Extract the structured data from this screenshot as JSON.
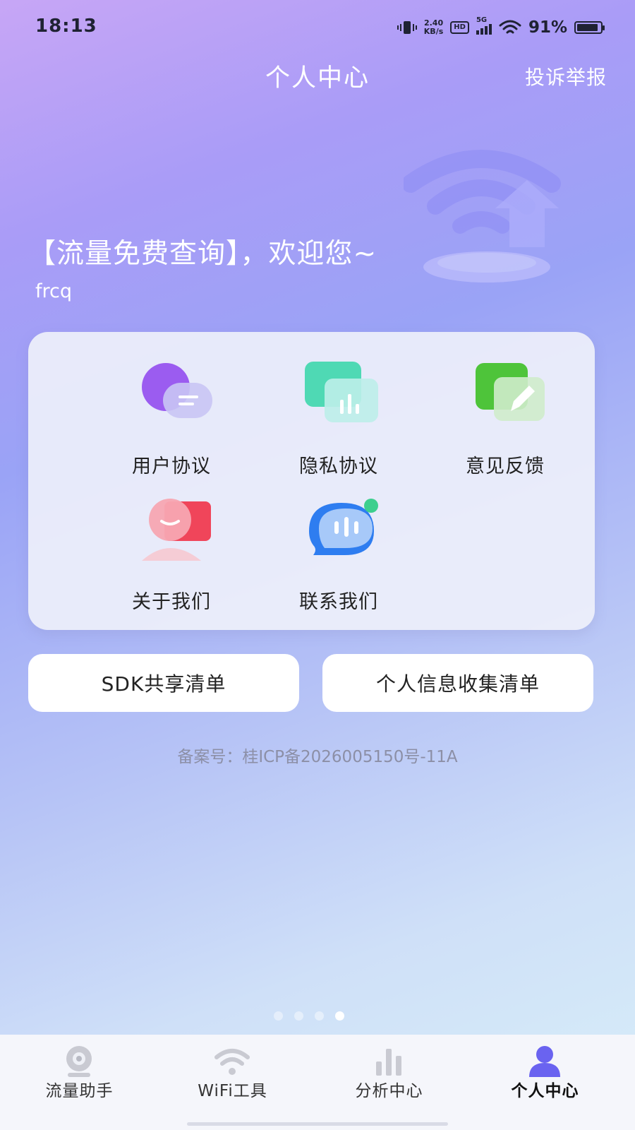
{
  "status_bar": {
    "time": "18:13",
    "net_speed": "2.40",
    "net_unit": "KB/s",
    "hd": "HD",
    "network": "5G",
    "battery_pct": "91%",
    "battery_level": 0.91
  },
  "header": {
    "title": "个人中心",
    "report": "投诉举报"
  },
  "profile": {
    "welcome": "【流量免费查询】，欢迎您~",
    "username": "frcq"
  },
  "menu": {
    "items": [
      {
        "label": "用户协议",
        "icon": "chat-bubble-icon"
      },
      {
        "label": "隐私协议",
        "icon": "chart-card-icon"
      },
      {
        "label": "意见反馈",
        "icon": "edit-note-icon"
      },
      {
        "label": "关于我们",
        "icon": "smile-profile-icon"
      },
      {
        "label": "联系我们",
        "icon": "message-contact-icon"
      }
    ]
  },
  "lists": {
    "sdk": "SDK共享清单",
    "personal_info": "个人信息收集清单"
  },
  "footer": {
    "icp": "备案号：桂ICP备2026005150号-11A"
  },
  "pager": {
    "count": 4,
    "active": 4
  },
  "tabs": [
    {
      "label": "流量助手",
      "icon": "camera-icon",
      "active": false
    },
    {
      "label": "WiFi工具",
      "icon": "wifi-icon",
      "active": false
    },
    {
      "label": "分析中心",
      "icon": "bar-chart-icon",
      "active": false
    },
    {
      "label": "个人中心",
      "icon": "person-icon",
      "active": true
    }
  ],
  "colors": {
    "accent": "#6a63f0",
    "card": "#eef0fa"
  }
}
